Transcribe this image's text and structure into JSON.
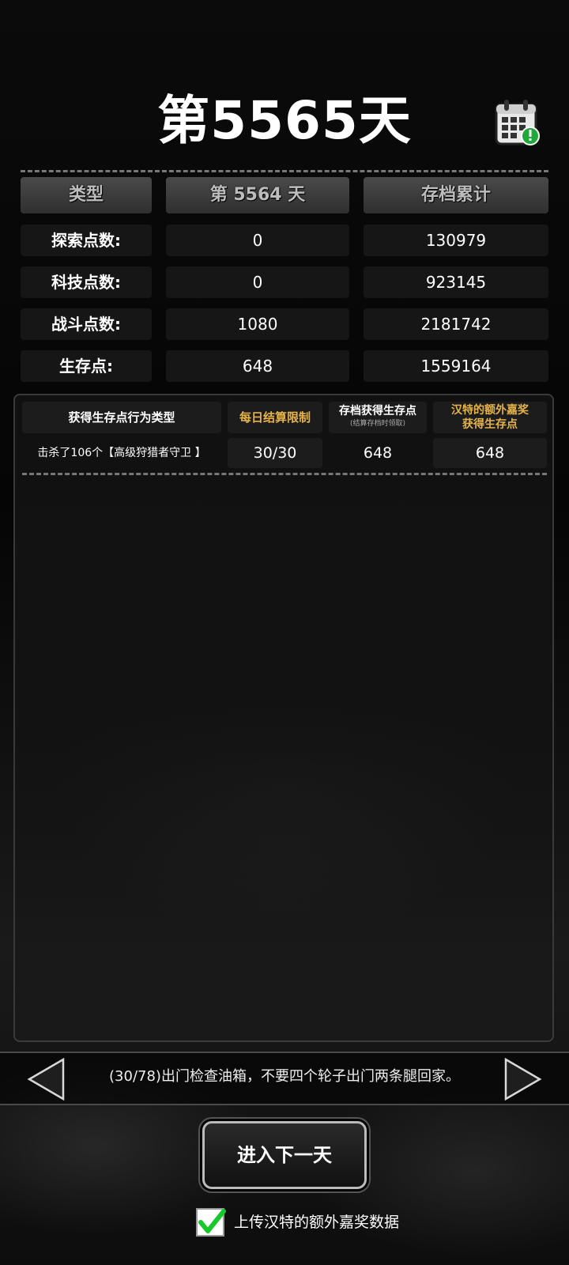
{
  "header": {
    "title": "第5565天",
    "calendar_icon": "calendar-alert-icon"
  },
  "stats": {
    "headers": [
      "类型",
      "第 5564 天",
      "存档累计"
    ],
    "rows": [
      {
        "label": "探索点数:",
        "today": "0",
        "total": "130979"
      },
      {
        "label": "科技点数:",
        "today": "0",
        "total": "923145"
      },
      {
        "label": "战斗点数:",
        "today": "1080",
        "total": "2181742"
      },
      {
        "label": "生存点:",
        "today": "648",
        "total": "1559164"
      }
    ]
  },
  "survival_table": {
    "headers": {
      "type": "获得生存点行为类型",
      "daily_limit": "每日结算限制",
      "save_points": "存档获得生存点",
      "save_points_note": "(结算存档时领取)",
      "bonus_line1": "汉特的额外嘉奖",
      "bonus_line2": "获得生存点"
    },
    "rows": [
      {
        "type": "击杀了106个【高级狩猎者守卫 】",
        "limit": "30/30",
        "points": "648",
        "bonus": "648"
      }
    ]
  },
  "hint": {
    "text": "(30/78)出门检查油箱，不要四个轮子出门两条腿回家。",
    "prev_icon": "triangle-left-icon",
    "next_icon": "triangle-right-icon"
  },
  "next_day_button": "进入下一天",
  "upload": {
    "label": "上传汉特的额外嘉奖数据",
    "checked": true
  },
  "colors": {
    "gold": "#e7b44a",
    "check_green": "#18c82a",
    "alert_green": "#22a83a"
  }
}
